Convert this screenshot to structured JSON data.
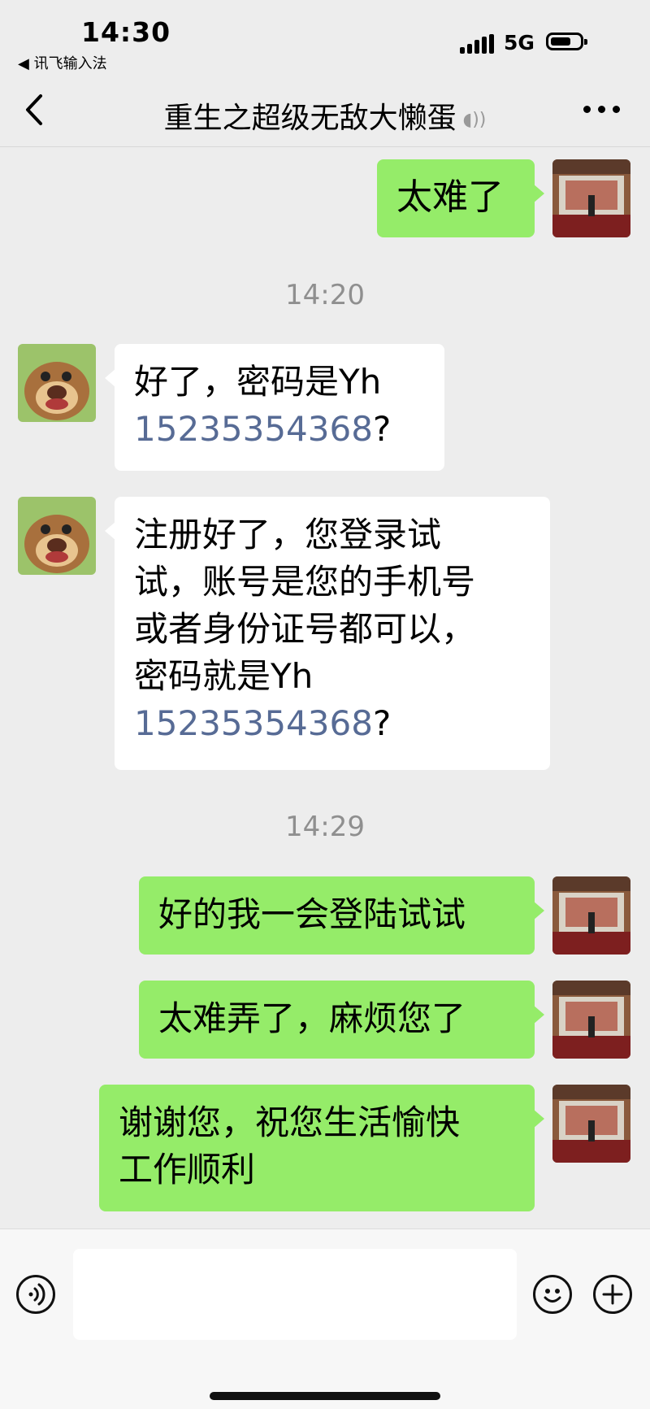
{
  "status": {
    "time": "14:30",
    "back_app": "◀ 讯飞输入法",
    "network": "5G"
  },
  "header": {
    "title": "重生之超级无敌大懒蛋",
    "voice_glyph": "◖))"
  },
  "chat": {
    "msg1": "太难了",
    "ts1": "14:20",
    "msg2_line1": "好了，密码是Yh",
    "msg2_number": "15235354368",
    "msg2_tail": "?",
    "msg3_l1": "注册好了，您登录试",
    "msg3_l2": "试，账号是您的手机号",
    "msg3_l3": "或者身份证号都可以，",
    "msg3_l4": "密码就是Yh",
    "msg3_number": "15235354368",
    "msg3_tail": "?",
    "ts2": "14:29",
    "msg4": "好的我一会登陆试试",
    "msg5": "太难弄了，麻烦您了",
    "msg6_l1": "谢谢您，祝您生活愉快",
    "msg6_l2": "工作顺利"
  },
  "colors": {
    "sent_bubble": "#95ec69",
    "received_bubble": "#ffffff",
    "link": "#576b95",
    "background": "#ededed"
  },
  "icons": [
    "chevron-left-icon",
    "more-icon",
    "voice-icon",
    "emoji-icon",
    "plus-icon"
  ]
}
